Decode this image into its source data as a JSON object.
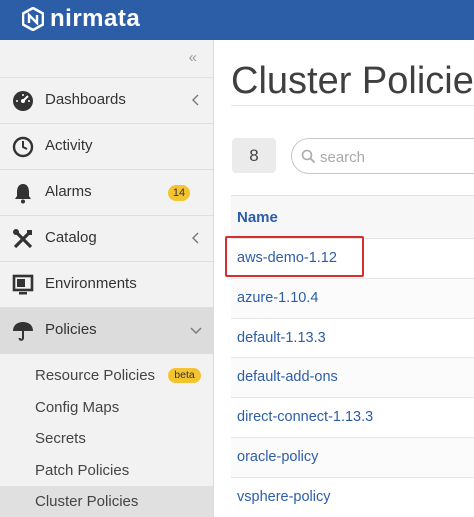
{
  "brand": {
    "name": "nirmata",
    "color": "#2c5ea8"
  },
  "sidebar": {
    "collapse_icon": "double-chevron-left-icon",
    "items": [
      {
        "label": "Dashboards",
        "icon": "dashboard-gauge-icon",
        "chevron": "left"
      },
      {
        "label": "Activity",
        "icon": "clock-icon"
      },
      {
        "label": "Alarms",
        "icon": "bell-icon",
        "badge": "14"
      },
      {
        "label": "Catalog",
        "icon": "tools-icon",
        "chevron": "left"
      },
      {
        "label": "Environments",
        "icon": "monitor-icon"
      },
      {
        "label": "Policies",
        "icon": "umbrella-icon",
        "chevron": "down",
        "active": true
      }
    ],
    "sub_items": [
      {
        "label": "Resource Policies",
        "badge": "beta"
      },
      {
        "label": "Config Maps"
      },
      {
        "label": "Secrets"
      },
      {
        "label": "Patch Policies"
      },
      {
        "label": "Cluster Policies",
        "active": true
      }
    ]
  },
  "main": {
    "title": "Cluster Policies",
    "count": "8",
    "search": {
      "placeholder": "search",
      "value": ""
    },
    "table": {
      "columns": [
        "Name"
      ],
      "rows": [
        "aws-demo-1.12",
        "azure-1.10.4",
        "default-1.13.3",
        "default-add-ons",
        "direct-connect-1.13.3",
        "oracle-policy",
        "vsphere-policy"
      ],
      "highlighted_row": "aws-demo-1.12",
      "highlight_color": "#d32f2f"
    }
  },
  "colors": {
    "badge": "#f4c430",
    "link": "#2c5ea8"
  }
}
